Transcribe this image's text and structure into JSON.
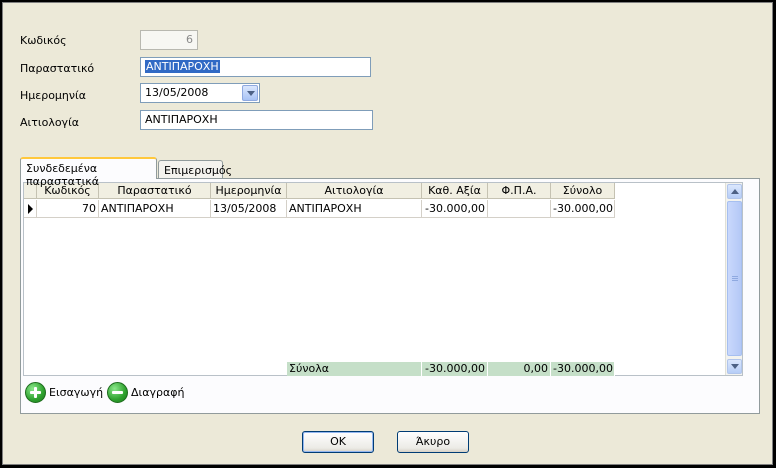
{
  "form": {
    "code_label": "Κωδικός",
    "code_value": "6",
    "doc_label": "Παραστατικό",
    "doc_value": "ΑΝΤΙΠΑΡΟΧΗ",
    "date_label": "Ημερομηνία",
    "date_value": "13/05/2008",
    "reason_label": "Αιτιολογία",
    "reason_value": "ΑΝΤΙΠΑΡΟΧΗ"
  },
  "tabs": [
    {
      "label": "Συνδεδεμένα παραστατικά",
      "active": true
    },
    {
      "label": "Επιμερισμός",
      "active": false
    }
  ],
  "grid": {
    "columns": [
      "Κωδικός",
      "Παραστατικό",
      "Ημερομηνία",
      "Αιτιολογία",
      "Καθ. Αξία",
      "Φ.Π.Α.",
      "Σύνολο"
    ],
    "rows": [
      [
        "70",
        "ΑΝΤΙΠΑΡΟΧΗ",
        "13/05/2008",
        "ΑΝΤΙΠΑΡΟΧΗ",
        "-30.000,00",
        "",
        "-30.000,00"
      ]
    ],
    "totals": {
      "label": "Σύνολα",
      "net": "-30.000,00",
      "vat": "0,00",
      "total": "-30.000,00"
    }
  },
  "actions": {
    "insert_label": "Εισαγωγή",
    "delete_label": "Διαγραφή",
    "ok_label": "OK",
    "cancel_label": "Άκυρο"
  },
  "colors": {
    "accent": "#ffc83c",
    "totals_bg": "#c5dfc8",
    "selection": "#316ac5",
    "action_green": "#2ea12e"
  }
}
